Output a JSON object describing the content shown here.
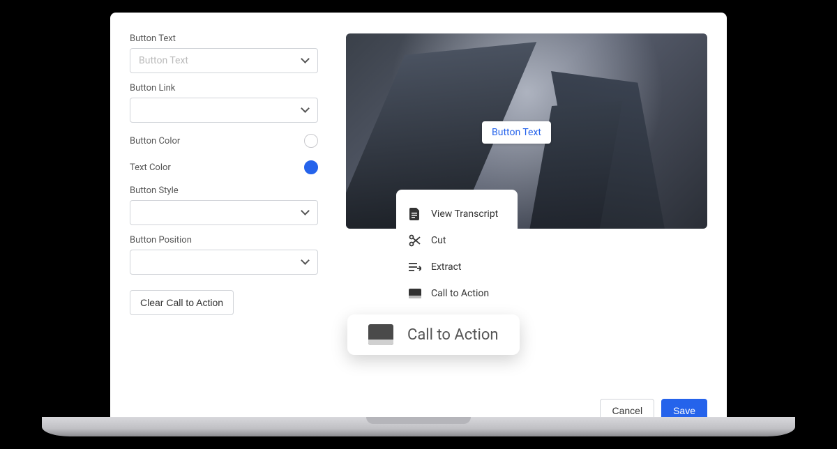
{
  "form": {
    "button_text": {
      "label": "Button Text",
      "placeholder": "Button Text",
      "value": ""
    },
    "button_link": {
      "label": "Button Link",
      "value": ""
    },
    "button_color": {
      "label": "Button Color",
      "value": "#ffffff"
    },
    "text_color": {
      "label": "Text Color",
      "value": "#2563eb"
    },
    "button_style": {
      "label": "Button Style",
      "value": ""
    },
    "button_position": {
      "label": "Button Position",
      "value": ""
    },
    "clear_label": "Clear Call to Action"
  },
  "preview": {
    "button_label": "Button Text"
  },
  "context_menu": {
    "items": [
      {
        "icon": "file-icon",
        "label": "View Transcript"
      },
      {
        "icon": "scissors-icon",
        "label": "Cut"
      },
      {
        "icon": "extract-icon",
        "label": "Extract"
      },
      {
        "icon": "cta-icon",
        "label": "Call to Action"
      }
    ]
  },
  "cta_pill": {
    "label": "Call to Action"
  },
  "footer": {
    "cancel": "Cancel",
    "save": "Save"
  }
}
